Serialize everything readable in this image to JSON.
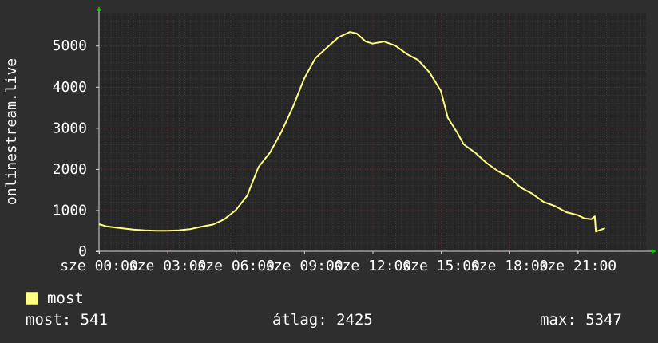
{
  "chart_data": {
    "type": "line",
    "title": "",
    "xlabel": "",
    "ylabel": "onlinestream.live",
    "ylim": [
      0,
      5800
    ],
    "xlim": [
      0,
      24
    ],
    "grid": true,
    "yticks": [
      0,
      1000,
      2000,
      3000,
      4000,
      5000
    ],
    "ytick_labels": [
      "0",
      "1000",
      "2000",
      "3000",
      "4000",
      "5000"
    ],
    "xticks": [
      0,
      3,
      6,
      9,
      12,
      15,
      18,
      21
    ],
    "xtick_labels": [
      "sze 00:00",
      "sze 03:00",
      "sze 06:00",
      "sze 09:00",
      "sze 12:00",
      "sze 15:00",
      "sze 18:00",
      "sze 21:00"
    ],
    "legend_position": "bottom-left",
    "colors": {
      "background": "#2e2e2e",
      "plot_background": "#262626",
      "grid_major": "#6a3030",
      "grid_minor": "#3c3c3c",
      "axis": "#d8d8d8",
      "arrow": "#00cc00",
      "series": "#ffff80"
    },
    "series": [
      {
        "name": "most",
        "x": [
          0,
          0.3,
          0.7,
          1.0,
          1.5,
          2.0,
          2.5,
          3.0,
          3.5,
          3.8,
          4.0,
          4.5,
          5.0,
          5.5,
          6.0,
          6.5,
          7.0,
          7.5,
          8.0,
          8.5,
          9.0,
          9.5,
          10.0,
          10.5,
          11.0,
          11.3,
          11.7,
          12.0,
          12.5,
          13.0,
          13.5,
          14.0,
          14.5,
          15.0,
          15.3,
          15.7,
          16.0,
          16.5,
          17.0,
          17.5,
          18.0,
          18.5,
          19.0,
          19.5,
          20.0,
          20.5,
          21.0,
          21.3,
          21.6,
          21.75,
          21.8,
          22.0,
          22.2
        ],
        "y": [
          660,
          610,
          580,
          560,
          530,
          510,
          500,
          500,
          510,
          530,
          540,
          600,
          650,
          780,
          1000,
          1350,
          2050,
          2400,
          2900,
          3500,
          4200,
          4700,
          4950,
          5200,
          5330,
          5300,
          5100,
          5050,
          5100,
          5000,
          4800,
          4650,
          4350,
          3900,
          3250,
          2900,
          2600,
          2400,
          2150,
          1950,
          1800,
          1550,
          1400,
          1200,
          1100,
          950,
          880,
          800,
          780,
          850,
          480,
          520,
          560
        ]
      }
    ]
  },
  "legend": {
    "series_label": "most",
    "swatch_color": "#ffff80"
  },
  "stats": {
    "now": "most: 541",
    "avg": "átlag: 2425",
    "max": "max: 5347"
  }
}
